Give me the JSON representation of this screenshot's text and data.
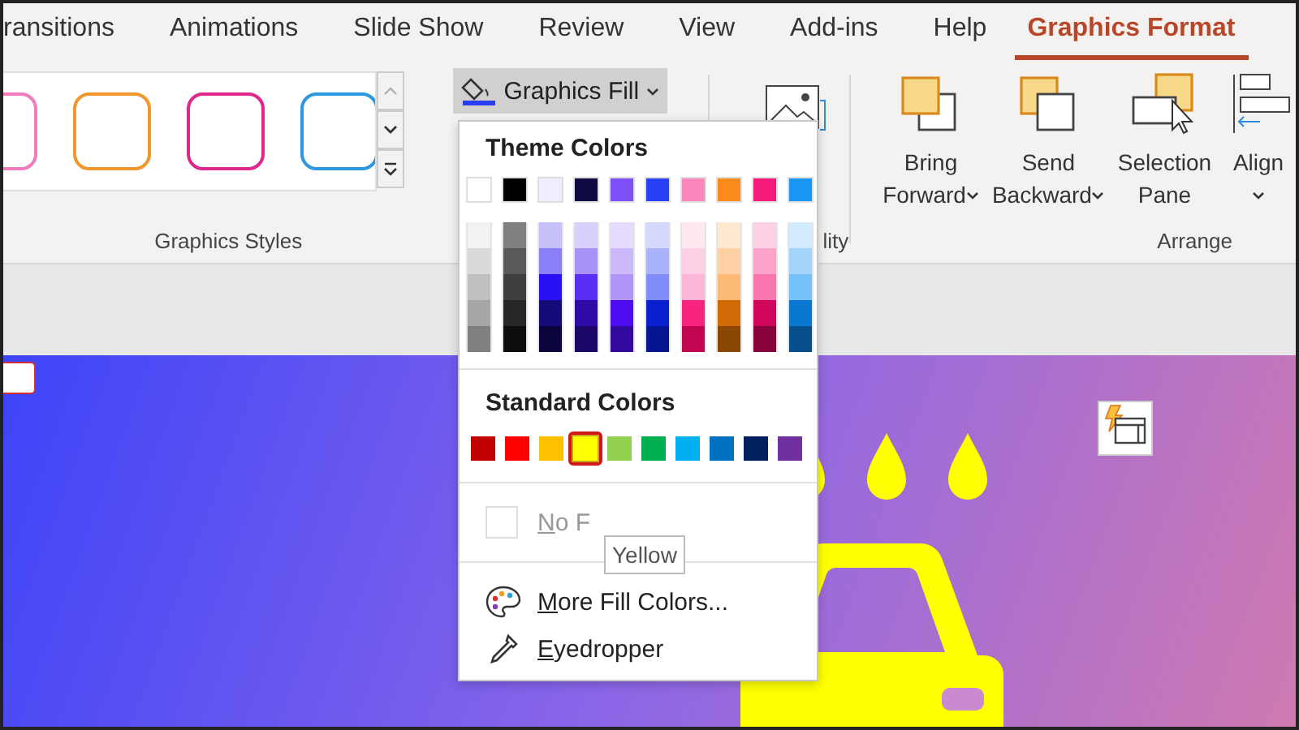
{
  "tabs": [
    {
      "label": "ransitions",
      "selected": false
    },
    {
      "label": "Animations",
      "selected": false
    },
    {
      "label": "Slide Show",
      "selected": false
    },
    {
      "label": "Review",
      "selected": false
    },
    {
      "label": "View",
      "selected": false
    },
    {
      "label": "Add-ins",
      "selected": false
    },
    {
      "label": "Help",
      "selected": false
    },
    {
      "label": "Graphics Format",
      "selected": true
    }
  ],
  "ribbon": {
    "styles_gallery": {
      "label": "Graphics Styles",
      "styles": [
        {
          "color": "#f07cc0"
        },
        {
          "color": "#f0962c"
        },
        {
          "color": "#e0288c"
        },
        {
          "color": "#2c98e0"
        }
      ]
    },
    "fill_button": {
      "label": "Graphics Fill",
      "expanded": true
    },
    "accessibility_group": {
      "label": "lity"
    },
    "arrange_group": {
      "label": "Arrange",
      "buttons": [
        {
          "kind": "bring",
          "line1": "Bring",
          "line2": "Forward"
        },
        {
          "kind": "send",
          "line1": "Send",
          "line2": "Backward"
        },
        {
          "kind": "pane",
          "line1": "Selection",
          "line2": "Pane"
        },
        {
          "kind": "align",
          "line1": "Align"
        }
      ]
    }
  },
  "fill_menu": {
    "theme_title": "Theme Colors",
    "theme_colors": [
      {
        "color": "#ffffff"
      },
      {
        "color": "#000000"
      },
      {
        "color": "#eeeeff"
      },
      {
        "color": "#0f0a40"
      },
      {
        "color": "#7f50f7"
      },
      {
        "color": "#2940f5"
      },
      {
        "color": "#fb86bb"
      },
      {
        "color": "#fb8c1c"
      },
      {
        "color": "#f51a7a"
      },
      {
        "color": "#1a96f5"
      }
    ],
    "shades": [
      {
        "swatches": [
          {
            "color": "#f2f2f2"
          },
          {
            "color": "#d9d9d9"
          },
          {
            "color": "#bfbfbf"
          },
          {
            "color": "#a6a6a6"
          },
          {
            "color": "#808080"
          }
        ]
      },
      {
        "swatches": [
          {
            "color": "#7f7f7f"
          },
          {
            "color": "#595959"
          },
          {
            "color": "#3f3f3f"
          },
          {
            "color": "#262626"
          },
          {
            "color": "#0d0d0d"
          }
        ]
      },
      {
        "swatches": [
          {
            "color": "#c6c0fb"
          },
          {
            "color": "#8a7ff7"
          },
          {
            "color": "#2a10f5"
          },
          {
            "color": "#150a7a"
          },
          {
            "color": "#0a053d"
          }
        ]
      },
      {
        "swatches": [
          {
            "color": "#d9d0fb"
          },
          {
            "color": "#a993f9"
          },
          {
            "color": "#5a2ff5"
          },
          {
            "color": "#2e0aa6"
          },
          {
            "color": "#1c0666"
          }
        ]
      },
      {
        "swatches": [
          {
            "color": "#e5dcfd"
          },
          {
            "color": "#cbb9fb"
          },
          {
            "color": "#b096f9"
          },
          {
            "color": "#4d0cf0"
          },
          {
            "color": "#330aa0"
          }
        ]
      },
      {
        "swatches": [
          {
            "color": "#d4d9fd"
          },
          {
            "color": "#a9b3fb"
          },
          {
            "color": "#7f8cf9"
          },
          {
            "color": "#0a1fd0"
          },
          {
            "color": "#061590"
          }
        ]
      },
      {
        "swatches": [
          {
            "color": "#fee7f1"
          },
          {
            "color": "#fdcfe4"
          },
          {
            "color": "#fcb6d6"
          },
          {
            "color": "#f8237f"
          },
          {
            "color": "#c00650"
          }
        ]
      },
      {
        "swatches": [
          {
            "color": "#fee8d2"
          },
          {
            "color": "#fdd1a4"
          },
          {
            "color": "#fcba76"
          },
          {
            "color": "#d06a04"
          },
          {
            "color": "#8a4603"
          }
        ]
      },
      {
        "swatches": [
          {
            "color": "#fdd1e4"
          },
          {
            "color": "#fba3c9"
          },
          {
            "color": "#f976ae"
          },
          {
            "color": "#d0065a"
          },
          {
            "color": "#8a043c"
          }
        ]
      },
      {
        "swatches": [
          {
            "color": "#d1eafd"
          },
          {
            "color": "#a3d5fb"
          },
          {
            "color": "#76c0f9"
          },
          {
            "color": "#0a77d0"
          },
          {
            "color": "#064f8a"
          }
        ]
      }
    ],
    "standard_title": "Standard Colors",
    "standard_colors": [
      {
        "color": "#c00000",
        "selected": false
      },
      {
        "color": "#ff0000",
        "selected": false
      },
      {
        "color": "#ffc000",
        "selected": false
      },
      {
        "color": "#ffff00",
        "selected": true
      },
      {
        "color": "#92d050",
        "selected": false
      },
      {
        "color": "#00b050",
        "selected": false
      },
      {
        "color": "#00b0f0",
        "selected": false
      },
      {
        "color": "#0070c0",
        "selected": false
      },
      {
        "color": "#002060",
        "selected": false
      },
      {
        "color": "#7030a0",
        "selected": false
      }
    ],
    "no_fill": {
      "label": "No F",
      "disabled": true
    },
    "tooltip": "Yellow",
    "items": [
      {
        "kind": "palette",
        "label": "More Fill Colors..."
      },
      {
        "kind": "eyedropper",
        "label": "Eyedropper"
      }
    ]
  }
}
